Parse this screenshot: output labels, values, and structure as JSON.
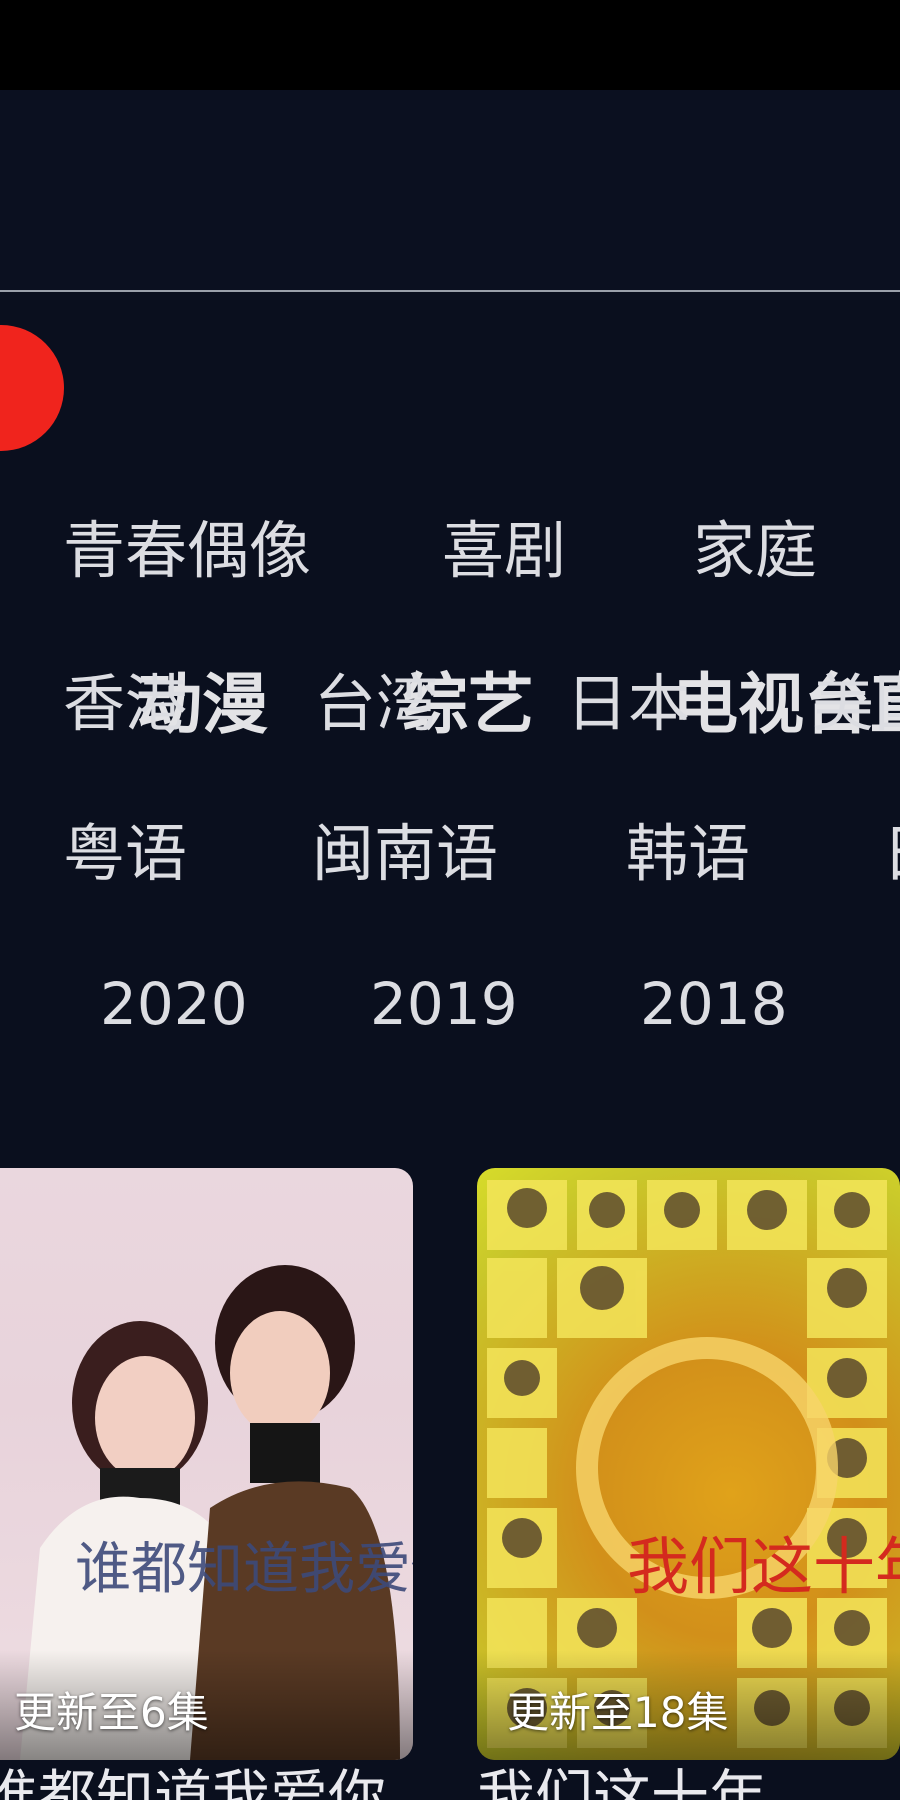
{
  "channel_tabs": {
    "active_index": 0,
    "items": [
      "动漫",
      "综艺",
      "电视台直播"
    ]
  },
  "filters": {
    "genre": [
      "青春偶像",
      "喜剧",
      "家庭"
    ],
    "region": [
      "香港",
      "台湾",
      "日本",
      "美国"
    ],
    "language": [
      "粤语",
      "闽南语",
      "韩语",
      "日语"
    ],
    "year": [
      "2020",
      "2019",
      "2018"
    ]
  },
  "posters": [
    {
      "update": "更新至6集",
      "title": "谁都知道我爱你",
      "artwork_text": "谁都知道我爱你"
    },
    {
      "update": "更新至18集",
      "title": "我们这十年",
      "artwork_text": "我们这十年"
    }
  ],
  "colors": {
    "background": "#0a0f1e",
    "accent": "#f0241d",
    "divider": "#9aa0aa"
  }
}
